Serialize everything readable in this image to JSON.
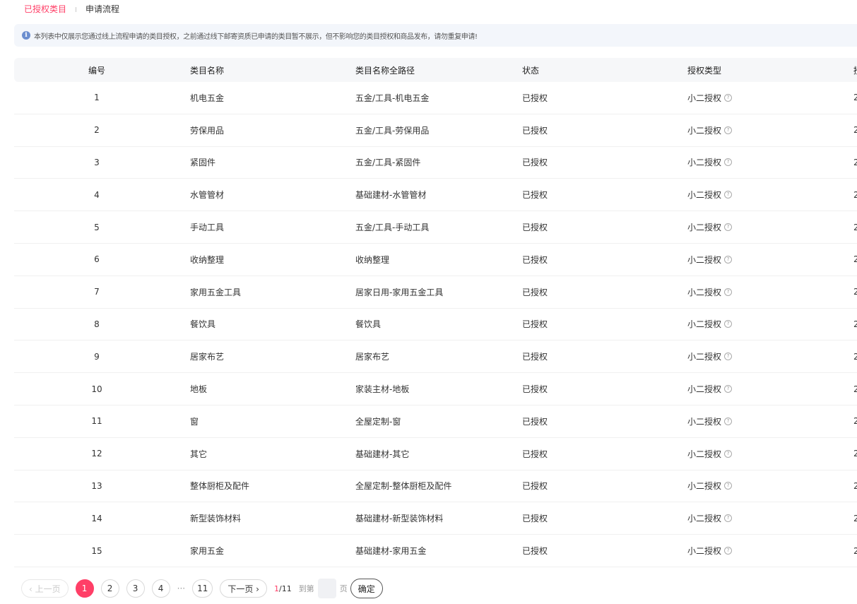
{
  "tabs": [
    {
      "label": "已授权类目",
      "active": true
    },
    {
      "label": "申请流程",
      "active": false
    }
  ],
  "notice": {
    "icon": "info-icon",
    "text": "本列表中仅展示您通过线上流程申请的类目授权，之前通过线下邮寄资质已申请的类目暂不展示，但不影响您的类目授权和商品发布，请勿重复申请!"
  },
  "table": {
    "headers": [
      "编号",
      "类目名称",
      "类目名称全路径",
      "状态",
      "授权类型",
      "授"
    ],
    "rows": [
      [
        "1",
        "机电五金",
        "五金/工具-机电五金",
        "已授权",
        "小二授权",
        "2"
      ],
      [
        "2",
        "劳保用品",
        "五金/工具-劳保用品",
        "已授权",
        "小二授权",
        "2"
      ],
      [
        "3",
        "紧固件",
        "五金/工具-紧固件",
        "已授权",
        "小二授权",
        "2"
      ],
      [
        "4",
        "水管管材",
        "基础建材-水管管材",
        "已授权",
        "小二授权",
        "2"
      ],
      [
        "5",
        "手动工具",
        "五金/工具-手动工具",
        "已授权",
        "小二授权",
        "2"
      ],
      [
        "6",
        "收纳整理",
        "收纳整理",
        "已授权",
        "小二授权",
        "2"
      ],
      [
        "7",
        "家用五金工具",
        "居家日用-家用五金工具",
        "已授权",
        "小二授权",
        "2"
      ],
      [
        "8",
        "餐饮具",
        "餐饮具",
        "已授权",
        "小二授权",
        "2"
      ],
      [
        "9",
        "居家布艺",
        "居家布艺",
        "已授权",
        "小二授权",
        "2"
      ],
      [
        "10",
        "地板",
        "家装主材-地板",
        "已授权",
        "小二授权",
        "2"
      ],
      [
        "11",
        "窗",
        "全屋定制-窗",
        "已授权",
        "小二授权",
        "2"
      ],
      [
        "12",
        "其它",
        "基础建材-其它",
        "已授权",
        "小二授权",
        "2"
      ],
      [
        "13",
        "整体厨柜及配件",
        "全屋定制-整体厨柜及配件",
        "已授权",
        "小二授权",
        "2"
      ],
      [
        "14",
        "新型装饰材料",
        "基础建材-新型装饰材料",
        "已授权",
        "小二授权",
        "2"
      ],
      [
        "15",
        "家用五金",
        "基础建材-家用五金",
        "已授权",
        "小二授权",
        "2"
      ]
    ]
  },
  "pagination": {
    "prev": "‹ 上一页",
    "pages": [
      "1",
      "2",
      "3",
      "4"
    ],
    "current": "1",
    "ellipsis": "···",
    "last": "11",
    "next": "下一页 ›",
    "current_page": "1",
    "total": "/11",
    "goto_prefix": "到第",
    "goto_suffix": "页",
    "confirm": "确定"
  },
  "colors": {
    "accent": "#ff3f67",
    "notice_bg": "#f3f6fb",
    "header_bg": "#f6f7f9"
  }
}
